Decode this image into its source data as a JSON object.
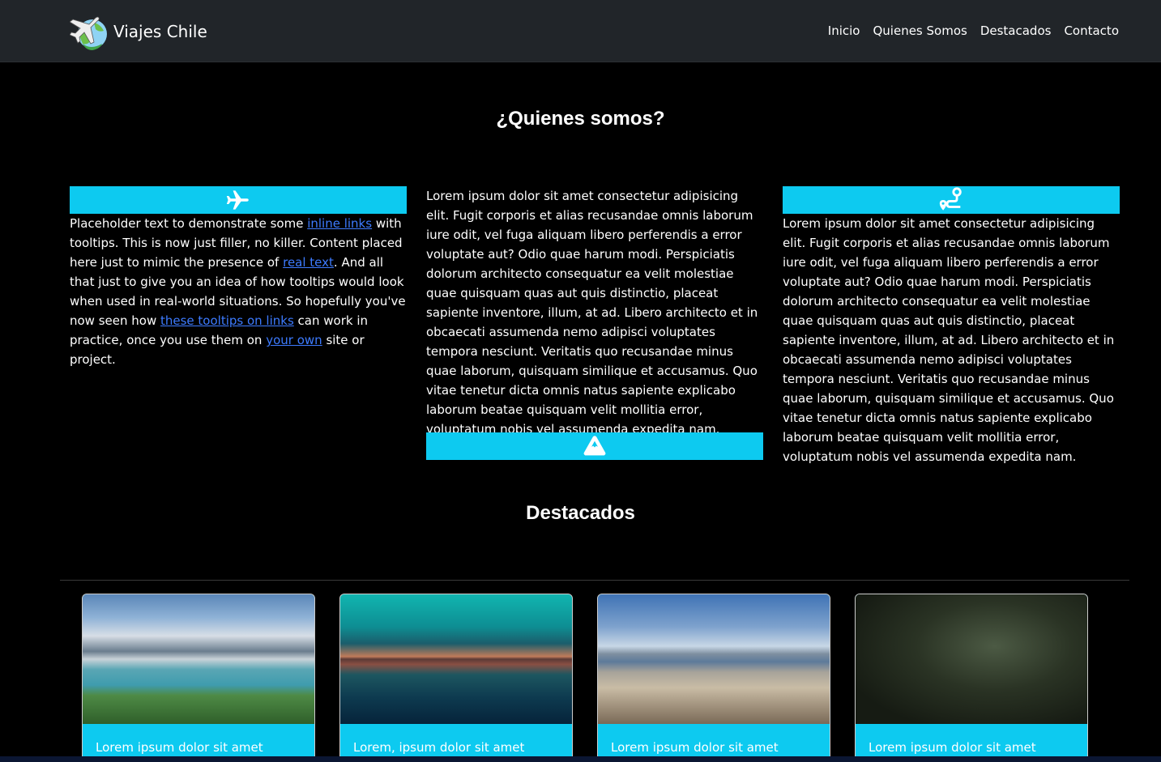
{
  "navbar": {
    "brand": "Viajes Chile",
    "links": [
      "Inicio",
      "Quienes Somos",
      "Destacados",
      "Contacto"
    ]
  },
  "about": {
    "title": "¿Quienes somos?",
    "col1": {
      "icon": "airplane-icon",
      "text_parts": [
        "Placeholder text to demonstrate some ",
        "inline links",
        " with tooltips. This is now just filler, no killer. Content placed here just to mimic the presence of ",
        "real text",
        ". And all that just to give you an idea of how tooltips would look when used in real-world situations. So hopefully you've now seen how ",
        "these tooltips on links",
        " can work in practice, once you use them on ",
        "your own",
        " site or project."
      ]
    },
    "col2": {
      "text": "Lorem ipsum dolor sit amet consectetur adipisicing elit. Fugit corporis et alias recusandae omnis laborum iure odit, vel fuga aliquam libero perferendis a error voluptate aut? Odio quae harum modi. Perspiciatis dolorum architecto consequatur ea velit molestiae quae quisquam quas aut quis distinctio, placeat sapiente inventore, illum, at ad. Libero architecto et in obcaecati assumenda nemo adipisci voluptates tempora nesciunt. Veritatis quo recusandae minus quae laborum, quisquam similique et accusamus. Quo vitae tenetur dicta omnis natus sapiente explicabo laborum beatae quisquam velit mollitia error, voluptatum nobis vel assumenda expedita nam.",
      "icon": "mountain-icon"
    },
    "col3": {
      "icon": "route-icon",
      "text": "Lorem ipsum dolor sit amet consectetur adipisicing elit. Fugit corporis et alias recusandae omnis laborum iure odit, vel fuga aliquam libero perferendis a error voluptate aut? Odio quae harum modi. Perspiciatis dolorum architecto consequatur ea velit molestiae quae quisquam quas aut quis distinctio, placeat sapiente inventore, illum, at ad. Libero architecto et in obcaecati assumenda nemo adipisci voluptates tempora nesciunt. Veritatis quo recusandae minus quae laborum, quisquam similique et accusamus. Quo vitae tenetur dicta omnis natus sapiente explicabo laborum beatae quisquam velit mollitia error, voluptatum nobis vel assumenda expedita nam."
    }
  },
  "featured": {
    "title": "Destacados",
    "cards": [
      {
        "caption": "Lorem ipsum dolor sit amet"
      },
      {
        "caption": "Lorem, ipsum dolor sit amet"
      },
      {
        "caption": "Lorem ipsum dolor sit amet"
      },
      {
        "caption": "Lorem ipsum dolor sit amet"
      }
    ]
  },
  "colors": {
    "accent": "#0dcaf0",
    "navbar_bg": "#212529",
    "link": "#3d7bff"
  }
}
